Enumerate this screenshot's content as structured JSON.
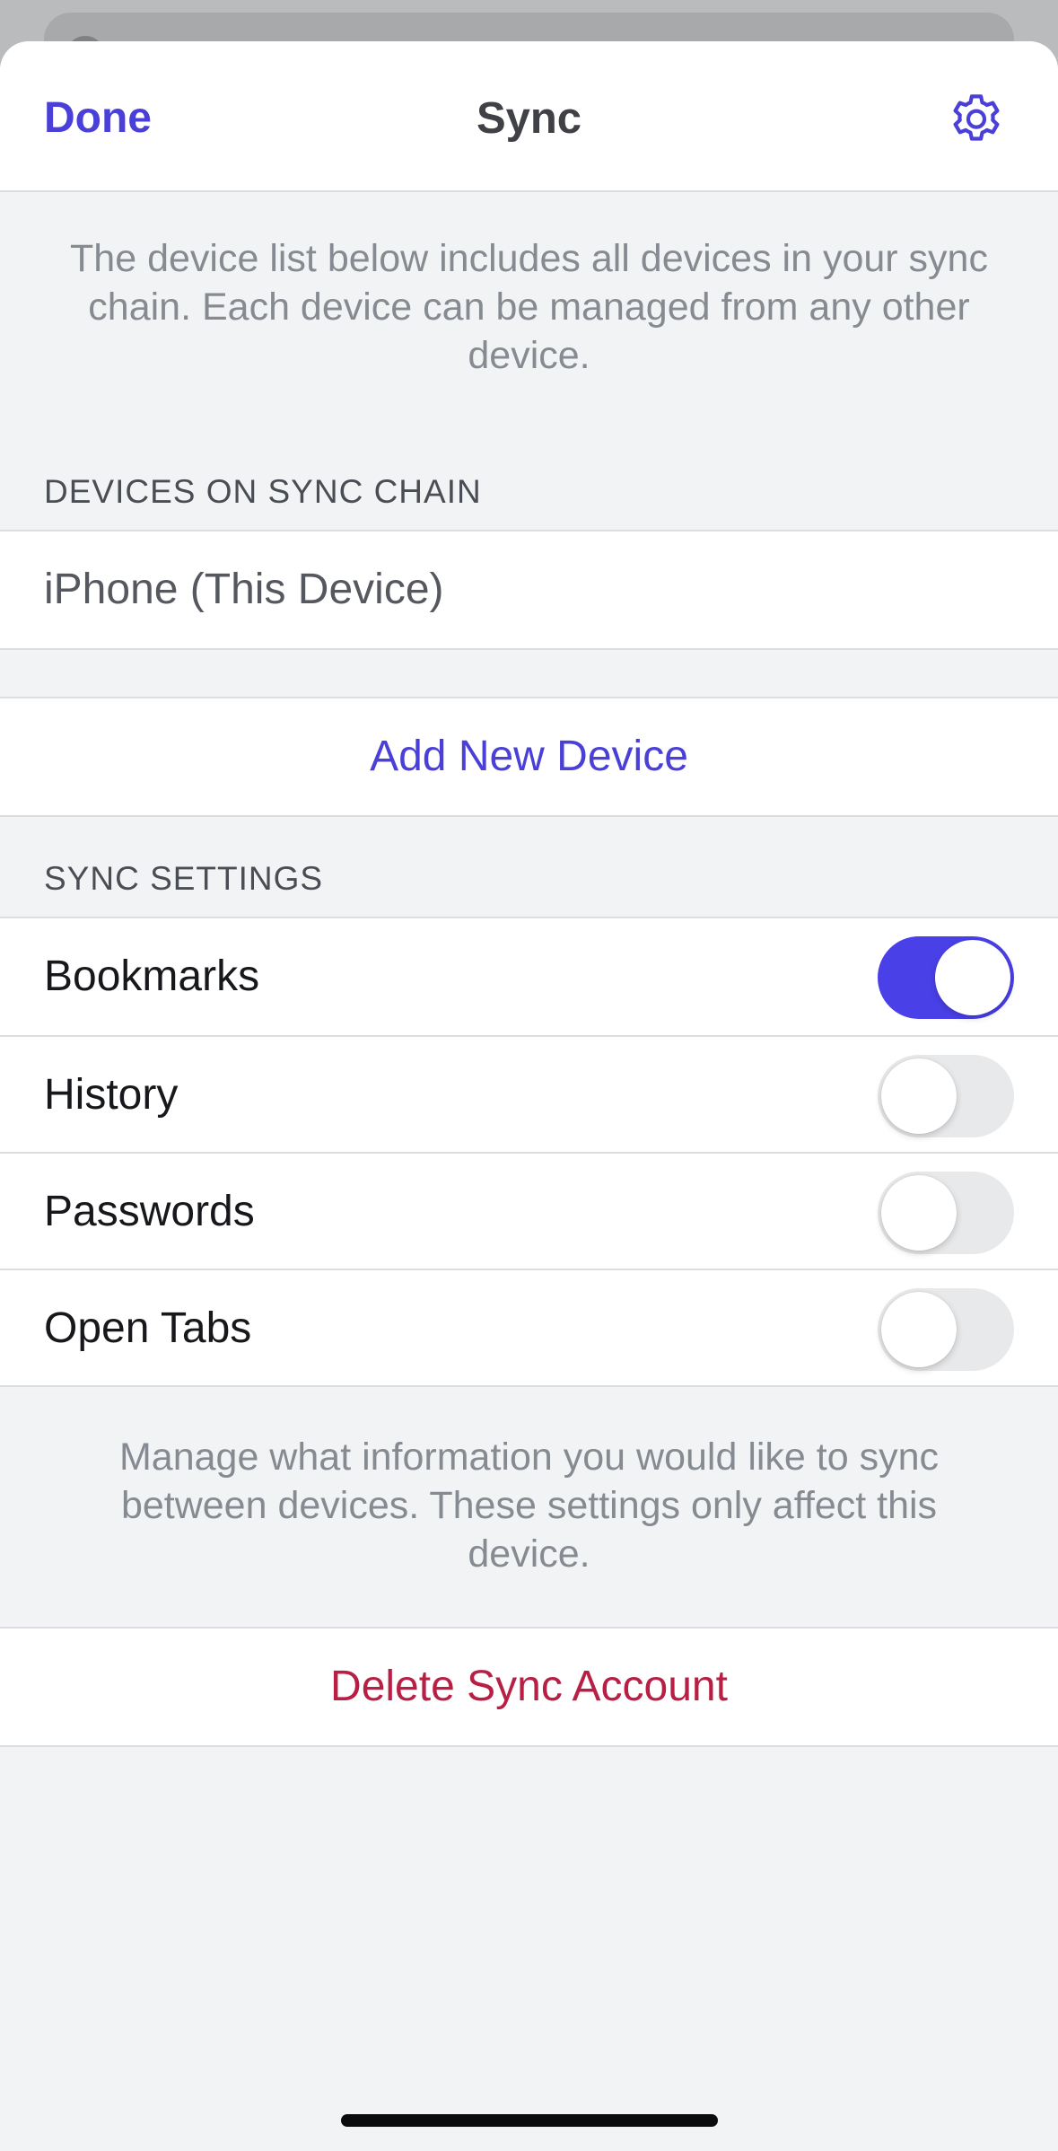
{
  "nav": {
    "done_label": "Done",
    "title": "Sync",
    "settings_icon": "gear-icon"
  },
  "intro_note": "The device list below includes all devices in your sync chain. Each device can be managed from any other device.",
  "devices_section": {
    "header": "DEVICES ON SYNC CHAIN",
    "devices": [
      {
        "label": "iPhone (This Device)"
      }
    ]
  },
  "add_device_label": "Add New Device",
  "sync_settings": {
    "header": "SYNC SETTINGS",
    "items": [
      {
        "label": "Bookmarks",
        "enabled": true
      },
      {
        "label": "History",
        "enabled": false
      },
      {
        "label": "Passwords",
        "enabled": false
      },
      {
        "label": "Open Tabs",
        "enabled": false
      }
    ],
    "footer_note": "Manage what information you would like to sync between devices. These settings only affect this device."
  },
  "delete_label": "Delete Sync Account",
  "colors": {
    "accent": "#4a40d8",
    "toggle_on": "#4a40e8",
    "destructive": "#b81f45",
    "background": "#f2f3f5"
  }
}
